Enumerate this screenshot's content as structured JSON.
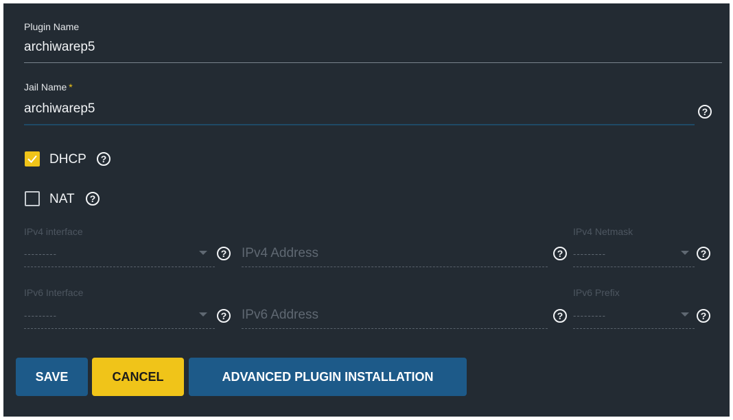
{
  "plugin_name": {
    "label": "Plugin Name",
    "value": "archiwarep5"
  },
  "jail_name": {
    "label": "Jail Name",
    "required_mark": "*",
    "value": "archiwarep5"
  },
  "help_glyph": "?",
  "dhcp": {
    "label": "DHCP",
    "checked": true
  },
  "nat": {
    "label": "NAT",
    "checked": false
  },
  "ipv4": {
    "interface_label": "IPv4 interface",
    "interface_value": "---------",
    "address_placeholder": "IPv4 Address",
    "netmask_label": "IPv4 Netmask",
    "netmask_value": "---------"
  },
  "ipv6": {
    "interface_label": "IPv6 Interface",
    "interface_value": "---------",
    "address_placeholder": "IPv6 Address",
    "prefix_label": "IPv6 Prefix",
    "prefix_value": "---------"
  },
  "buttons": {
    "save": "SAVE",
    "cancel": "CANCEL",
    "advanced": "ADVANCED PLUGIN INSTALLATION"
  },
  "colors": {
    "background": "#232b33",
    "accent_yellow": "#f0c419",
    "button_blue": "#1d5a89"
  }
}
